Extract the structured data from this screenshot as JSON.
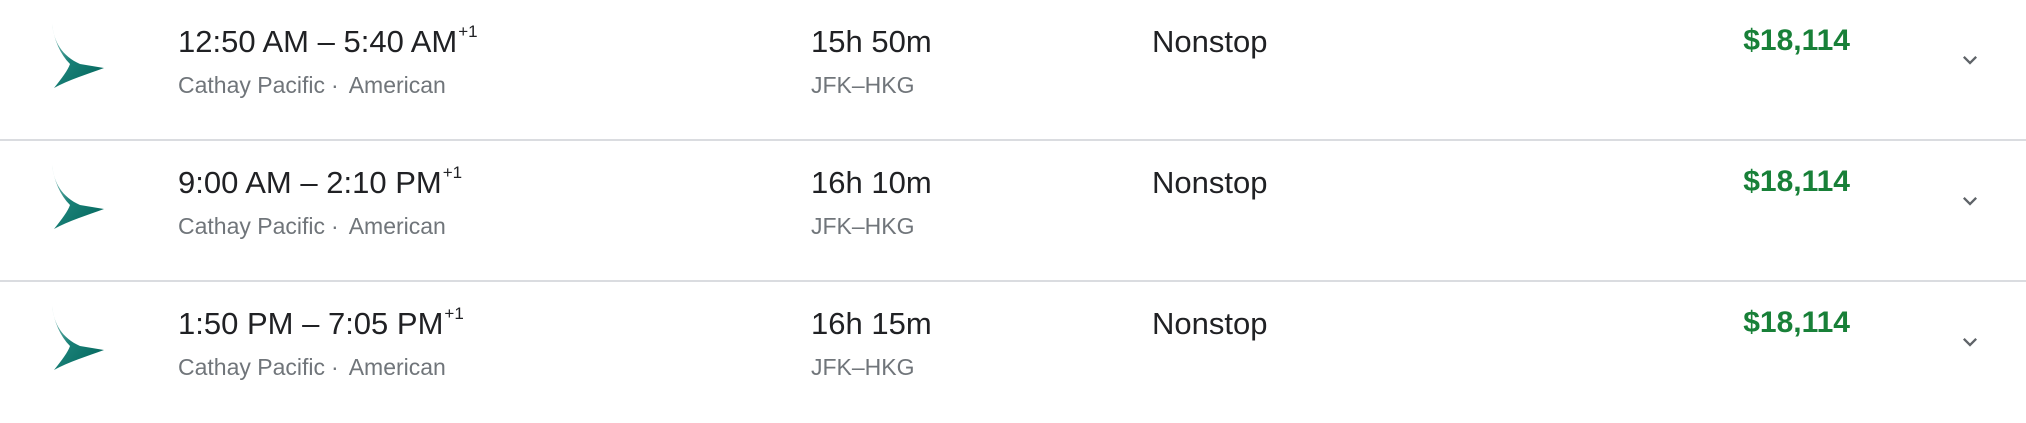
{
  "flights": [
    {
      "depart": "12:50 AM",
      "arrive": "5:40 AM",
      "day_offset": "+1",
      "separator": "–",
      "airline_primary": "Cathay Pacific",
      "airline_dot": "·",
      "airline_secondary": "American",
      "duration": "15h 50m",
      "route": "JFK–HKG",
      "stops": "Nonstop",
      "price": "$18,114"
    },
    {
      "depart": "9:00 AM",
      "arrive": "2:10 PM",
      "day_offset": "+1",
      "separator": "–",
      "airline_primary": "Cathay Pacific",
      "airline_dot": "·",
      "airline_secondary": "American",
      "duration": "16h 10m",
      "route": "JFK–HKG",
      "stops": "Nonstop",
      "price": "$18,114"
    },
    {
      "depart": "1:50 PM",
      "arrive": "7:05 PM",
      "day_offset": "+1",
      "separator": "–",
      "airline_primary": "Cathay Pacific",
      "airline_dot": "·",
      "airline_secondary": "American",
      "duration": "16h 15m",
      "route": "JFK–HKG",
      "stops": "Nonstop",
      "price": "$18,114"
    }
  ],
  "icons": {
    "airline_logo": "cathay-pacific-logo-icon",
    "expand": "chevron-down-icon"
  },
  "colors": {
    "price": "#188038",
    "logo_teal": "#00645A",
    "divider": "#dadce0",
    "secondary_text": "#70757a"
  }
}
